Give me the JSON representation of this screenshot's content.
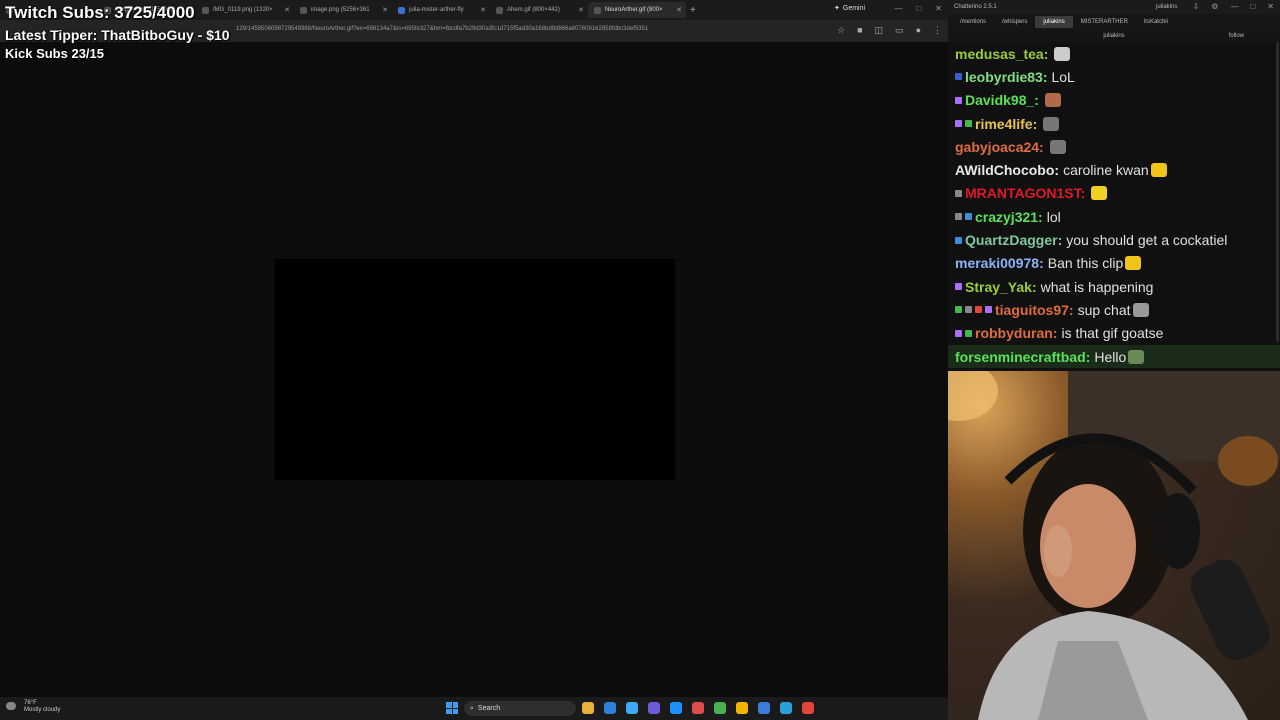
{
  "overlay": {
    "twitch_subs": "Twitch Subs: 3725/4000",
    "latest_tipper": "Latest Tipper: ThatBitboGuy - $10",
    "kick_subs": "Kick Subs 23/15"
  },
  "browser": {
    "tabs": [
      {
        "label": "",
        "active": false
      },
      {
        "label": "image.png (1325×942)",
        "active": false
      },
      {
        "label": "IMG_0119.png (1320×",
        "active": false
      },
      {
        "label": "image.png (5256×361",
        "active": false
      },
      {
        "label": "julia-mister-arther-fly",
        "active": false
      },
      {
        "label": "Ahem.gif (800×442)",
        "active": false
      },
      {
        "label": "NeuroArther.gif (800×",
        "active": true
      }
    ],
    "gemini_label": "Gemini",
    "url": "129/1458506098729549988/NeuroArther.gif?ex=696134a7&is=695fe327&hm=fbcdfa7b29d30a3fc1d715f5ad30a168bd9d866a807609162858fdbc3def5351"
  },
  "taskbar": {
    "weather_temp": "76°F",
    "weather_desc": "Mostly cloudy",
    "search_label": "Search",
    "app_colors": [
      "#e8b33a",
      "#2d7fd8",
      "#3fa9f5",
      "#6b5bd6",
      "#1e90ff",
      "#e04a4a",
      "#4caf50",
      "#f5b400",
      "#3b7ddd",
      "#2aa0d8",
      "#e0443c"
    ]
  },
  "chatterino": {
    "title": "Chatterino 2.5.1",
    "user": "juliakins",
    "tabs": [
      "/mentions",
      "/whispers",
      "juliakins",
      "MISTERARTHER",
      "itsKatchii"
    ],
    "active_tab": 2,
    "channel": "juliakins",
    "follow_label": "follow",
    "messages": [
      {
        "user": "medusas_tea:",
        "color": "#9acd32",
        "text": "",
        "badges": [],
        "emote": "#cccccc"
      },
      {
        "user": "leobyrdie83:",
        "color": "#7ee07e",
        "text": "LoL",
        "badges": [
          "#3a5fcd"
        ],
        "emote": null
      },
      {
        "user": "Davidk98_:",
        "color": "#57e257",
        "text": "",
        "badges": [
          "#a970ff"
        ],
        "emote": "#b06a4a"
      },
      {
        "user": "rime4life:",
        "color": "#e8c34a",
        "text": "",
        "badges": [
          "#a970ff",
          "#3fb950"
        ],
        "emote": "#777777"
      },
      {
        "user": "gabyjoaca24:",
        "color": "#e06c3a",
        "text": "",
        "badges": [],
        "emote": "#777777"
      },
      {
        "user": "AWildChocobo:",
        "color": "#e8e8e8",
        "text": "caroline kwan",
        "badges": [],
        "emote": "#f0c419"
      },
      {
        "user": "MRANTAGON1ST:",
        "color": "#e0192a",
        "text": "",
        "badges": [
          "#888888"
        ],
        "emote": "#f0d020"
      },
      {
        "user": "crazyj321:",
        "color": "#57e257",
        "text": "lol",
        "badges": [
          "#888888",
          "#3a8fd8"
        ],
        "emote": null
      },
      {
        "user": "QuartzDagger:",
        "color": "#7ec8a0",
        "text": "you should get a cockatiel",
        "badges": [
          "#3a8fd8"
        ],
        "emote": null
      },
      {
        "user": "meraki00978:",
        "color": "#8ab4f8",
        "text": "Ban this clip",
        "badges": [],
        "emote": "#f0c419"
      },
      {
        "user": "Stray_Yak:",
        "color": "#9acd32",
        "text": "what is happening",
        "badges": [
          "#a970ff"
        ],
        "emote": null
      },
      {
        "user": "tiaguitos97:",
        "color": "#e06c3a",
        "text": "sup chat",
        "badges": [
          "#3fb950",
          "#888888",
          "#e0443c",
          "#a970ff"
        ],
        "emote": "#999999"
      },
      {
        "user": "robbyduran:",
        "color": "#e06c3a",
        "text": "is that gif goatse",
        "badges": [
          "#a970ff",
          "#3fb950"
        ],
        "emote": null
      },
      {
        "user": "forsenminecraftbad:",
        "color": "#57e257",
        "text": "Hello",
        "badges": [],
        "emote": "#6a8a5a"
      }
    ]
  }
}
